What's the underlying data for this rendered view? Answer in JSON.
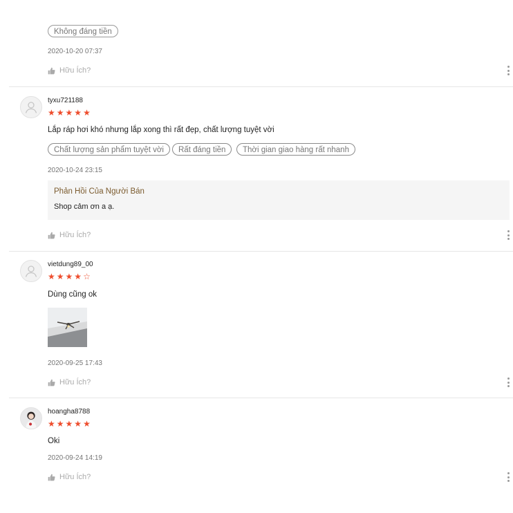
{
  "reviews": [
    {
      "tags": [
        "Không đáng tiền"
      ],
      "date": "2020-10-20 07:37",
      "helpful_label": "Hữu Ích?"
    },
    {
      "username": "tyxu721188",
      "rating": 5,
      "comment": "Lắp ráp hơi khó nhưng lắp xong thì rất đẹp, chất lượng tuyệt vời",
      "tags": [
        "Chất lượng sản phẩm tuyệt vời",
        "Rất đáng tiền",
        "Thời gian giao hàng rất nhanh"
      ],
      "date": "2020-10-24 23:15",
      "seller_reply": {
        "title": "Phản Hồi Của Người Bán",
        "text": "Shop cảm ơn a ạ."
      },
      "helpful_label": "Hữu Ích?"
    },
    {
      "username": "vietdung89_00",
      "rating": 4,
      "comment": "Dùng cũng ok",
      "has_photo": true,
      "date": "2020-09-25 17:43",
      "helpful_label": "Hữu Ích?"
    },
    {
      "username": "hoangha8788",
      "rating": 5,
      "comment": "Oki",
      "date": "2020-09-24 14:19",
      "helpful_label": "Hữu Ích?"
    }
  ],
  "colors": {
    "star": "#ee4d2d",
    "reply_title": "#7b5b2e",
    "divider": "#e6e6e6"
  },
  "icons": [
    "thumbs-up-icon",
    "more-vertical-icon",
    "user-avatar-icon",
    "star-icon"
  ]
}
